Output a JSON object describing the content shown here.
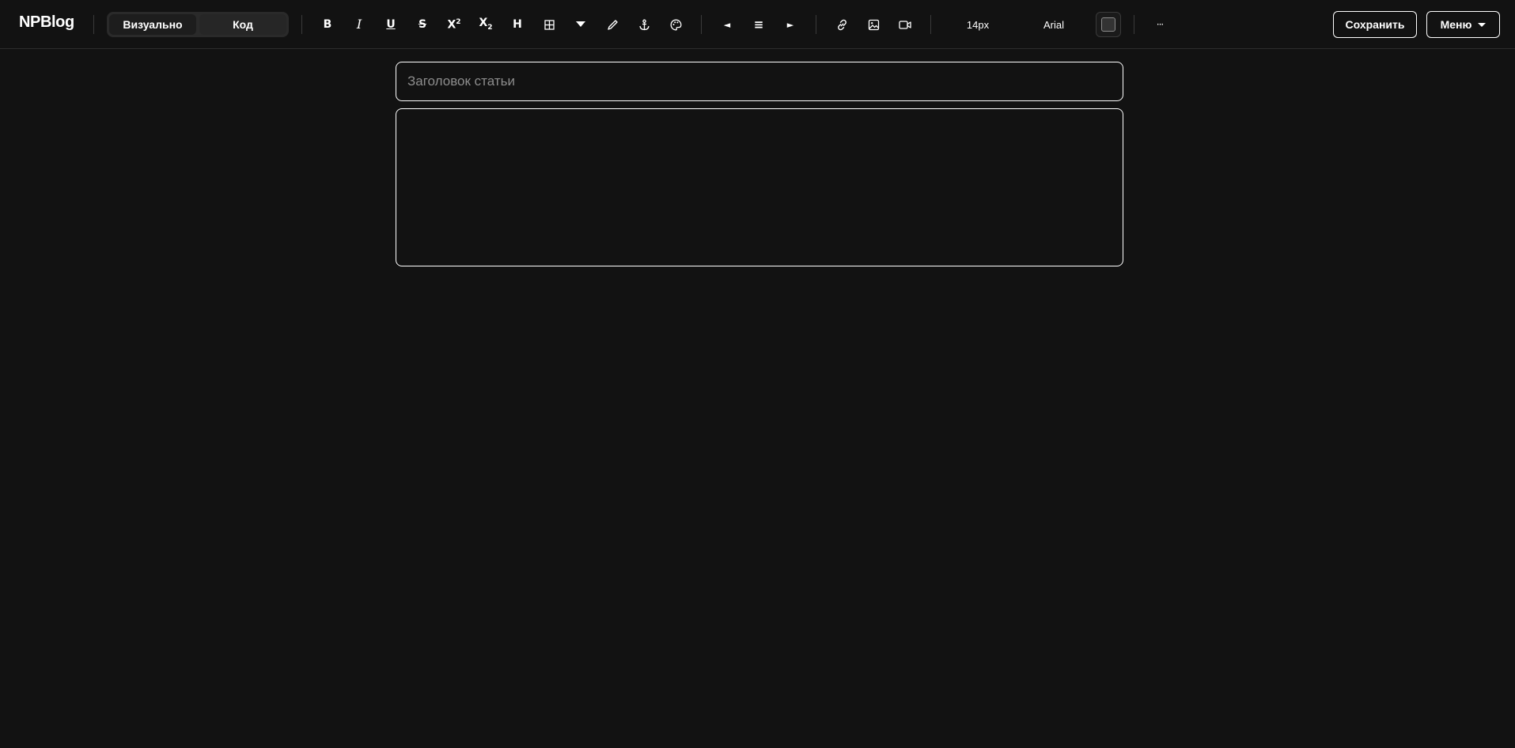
{
  "app": {
    "brand": "NPBlog"
  },
  "modes": {
    "visual_label": "Визуально",
    "code_label": "Код"
  },
  "toolbar": {
    "bold": "B",
    "italic": "I",
    "underline": "U",
    "strike": "S",
    "superscript_base": "X",
    "superscript_mark": "2",
    "subscript_base": "X",
    "subscript_mark": "2",
    "heading": "H",
    "align_left": "◄",
    "align_center": "≡",
    "align_right": "►",
    "more": "···",
    "font_size": "14px",
    "font_family": "Arial",
    "text_color": "#333333"
  },
  "icons": [
    "table-icon",
    "dropdown-caret-icon",
    "pen-icon",
    "anchor-icon",
    "palette-icon",
    "link-icon",
    "image-icon",
    "video-icon"
  ],
  "actions": {
    "save_label": "Сохранить",
    "menu_label": "Меню"
  },
  "editor": {
    "title_placeholder": "Заголовок статьи",
    "title_value": "",
    "content": ""
  },
  "colors": {
    "background": "#121212",
    "border": "#ffffff",
    "placeholder": "#8d8d8d"
  }
}
